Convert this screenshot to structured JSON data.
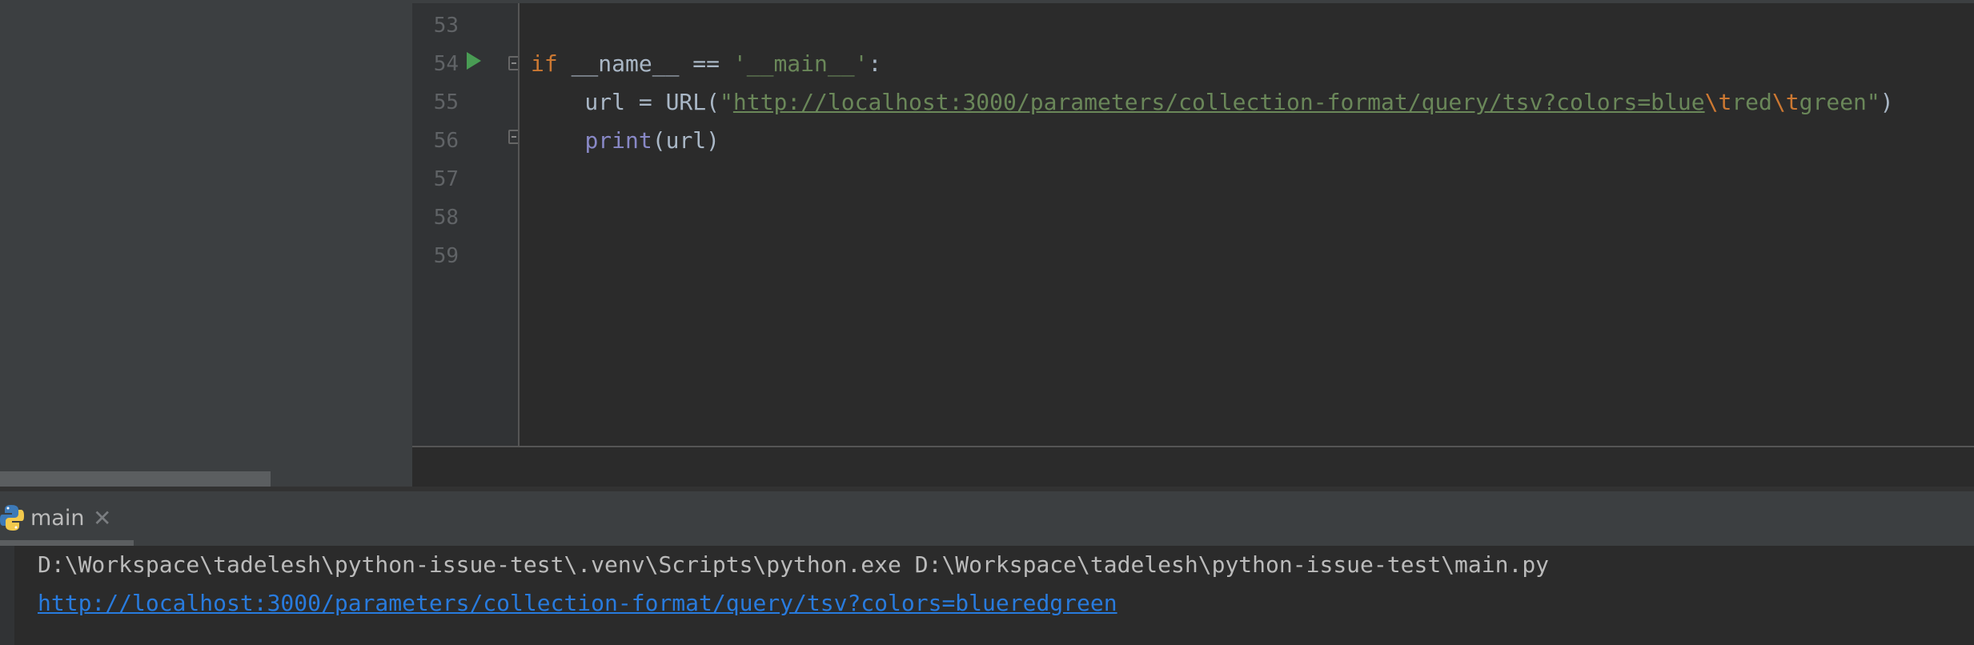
{
  "editor": {
    "line_numbers": [
      "53",
      "54",
      "55",
      "56",
      "57",
      "58",
      "59"
    ],
    "code": {
      "line54": {
        "kw_if": "if",
        "name": " __name__ == ",
        "str_main": "'__main__'",
        "colon": ":"
      },
      "line55": {
        "indent_and_assign": "    url = URL(",
        "quote_open": "\"",
        "url_part": "http://localhost:3000/parameters/collection-format/query/tsv?colors=blue",
        "esc1": "\\t",
        "red": "red",
        "esc2": "\\t",
        "green": "green\"",
        "close": ")"
      },
      "line56": {
        "indent": "    ",
        "print_kw": "print",
        "args": "(url)"
      }
    }
  },
  "run_panel": {
    "tab_label": "main",
    "close_glyph": "✕",
    "command_line": "D:\\Workspace\\tadelesh\\python-issue-test\\.venv\\Scripts\\python.exe D:\\Workspace\\tadelesh\\python-issue-test\\main.py",
    "output_link": "http://localhost:3000/parameters/collection-format/query/tsv?colors=blueredgreen"
  },
  "icons": {
    "run": "run-arrow-icon",
    "fold": "fold-marker-icon",
    "python": "python-icon",
    "close": "close-icon"
  },
  "colors": {
    "keyword": "#cc7832",
    "string": "#6a8759",
    "builtin": "#8888c6",
    "link": "#287bde",
    "run_green": "#499c54"
  }
}
